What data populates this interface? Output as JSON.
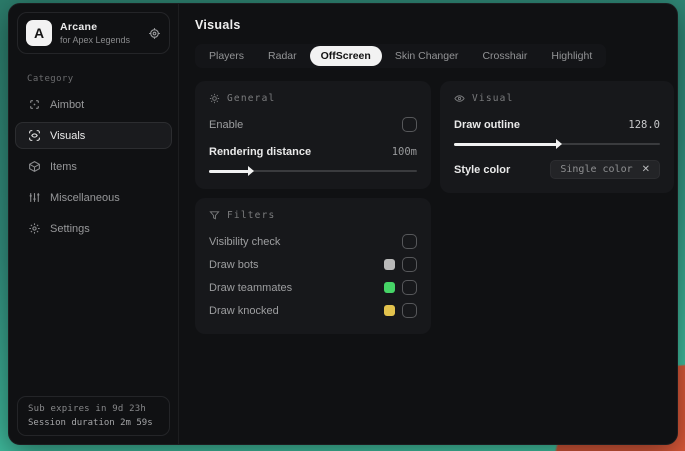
{
  "app": {
    "logo_letter": "A",
    "name": "Arcane",
    "subtitle": "for Apex Legends"
  },
  "sidebar": {
    "category_label": "Category",
    "items": [
      {
        "label": "Aimbot"
      },
      {
        "label": "Visuals"
      },
      {
        "label": "Items"
      },
      {
        "label": "Miscellaneous"
      },
      {
        "label": "Settings"
      }
    ],
    "session": {
      "line1": "Sub expires in 9d 23h",
      "line2": "Session duration 2m 59s"
    }
  },
  "main": {
    "title": "Visuals",
    "tabs": [
      {
        "label": "Players"
      },
      {
        "label": "Radar"
      },
      {
        "label": "OffScreen"
      },
      {
        "label": "Skin Changer"
      },
      {
        "label": "Crosshair"
      },
      {
        "label": "Highlight"
      }
    ],
    "panels": {
      "general": {
        "title": "General",
        "rows": [
          {
            "label": "Enable",
            "checked": false
          },
          {
            "label": "Rendering distance",
            "value": "100m",
            "fill_style": "width:19%",
            "thumb_style": "left:19%"
          }
        ]
      },
      "visual": {
        "title": "Visual",
        "rows": [
          {
            "label": "Draw outline",
            "value": "128.0",
            "fill_style": "width:50%",
            "thumb_style": "left:50%"
          },
          {
            "label": "Style color",
            "chip_label": "Single color"
          }
        ]
      },
      "filters": {
        "title": "Filters",
        "rows": [
          {
            "label": "Visibility check",
            "checked": false
          },
          {
            "label": "Draw bots",
            "swatch_style": "background:#b9b9b9",
            "checked": false
          },
          {
            "label": "Draw teammates",
            "swatch_style": "background:#46d467",
            "checked": false
          },
          {
            "label": "Draw knocked",
            "swatch_style": "background:#e2c24d",
            "checked": false
          }
        ]
      }
    }
  },
  "icons": {
    "close": "✕"
  },
  "colors": {
    "accent_teal": "#47d3ae",
    "accent_orange": "#dd5a3a",
    "swatch_gray": "#b9b9b9",
    "swatch_green": "#46d467",
    "swatch_yellow": "#e2c24d"
  }
}
